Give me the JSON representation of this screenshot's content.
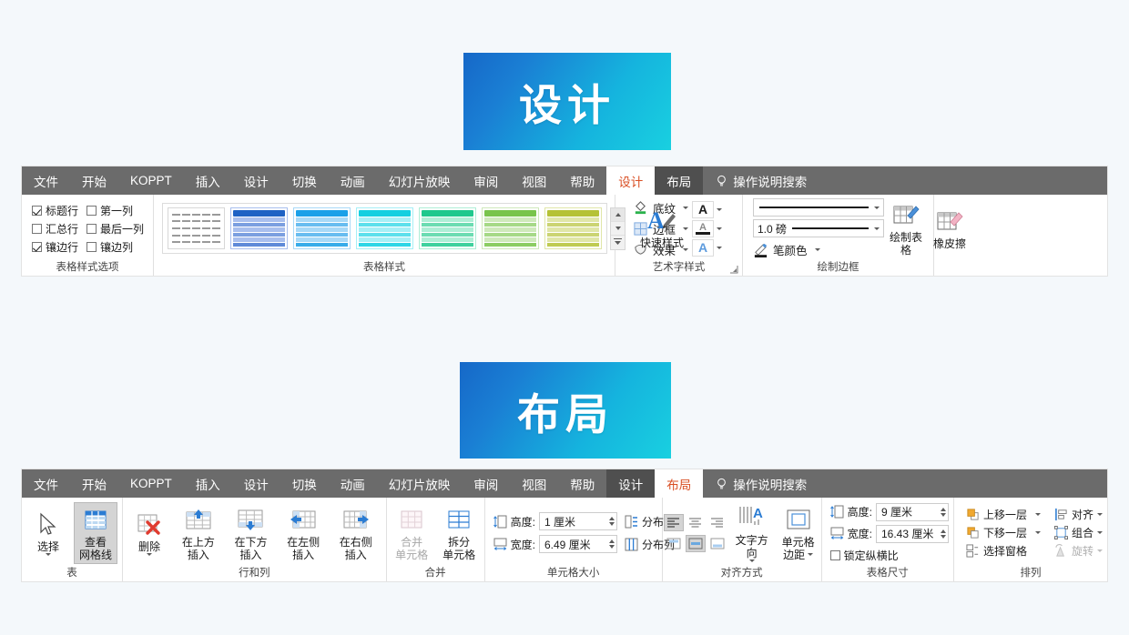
{
  "banners": {
    "design": "设计",
    "layout": "布局"
  },
  "colors": {
    "tabbar_bg": "#6b6b6b",
    "context_tab_bg": "#4f4f4f",
    "active_tab_text": "#d94f24",
    "banner_gradient_start": "#1668c8",
    "banner_gradient_end": "#19d0e0",
    "accent_blue": "#2b7cd3"
  },
  "ribbon_design": {
    "tabs": [
      {
        "label": "文件",
        "state": "normal"
      },
      {
        "label": "开始",
        "state": "normal"
      },
      {
        "label": "KOPPT",
        "state": "normal"
      },
      {
        "label": "插入",
        "state": "normal"
      },
      {
        "label": "设计",
        "state": "normal"
      },
      {
        "label": "切换",
        "state": "normal"
      },
      {
        "label": "动画",
        "state": "normal"
      },
      {
        "label": "幻灯片放映",
        "state": "normal"
      },
      {
        "label": "审阅",
        "state": "normal"
      },
      {
        "label": "视图",
        "state": "normal"
      },
      {
        "label": "帮助",
        "state": "normal"
      },
      {
        "label": "设计",
        "state": "active"
      },
      {
        "label": "布局",
        "state": "context"
      }
    ],
    "tell_me": "操作说明搜索",
    "groups": {
      "table_style_options": {
        "label": "表格样式选项",
        "checkboxes": [
          {
            "label": "标题行",
            "checked": true
          },
          {
            "label": "第一列",
            "checked": false
          },
          {
            "label": "汇总行",
            "checked": false
          },
          {
            "label": "最后一列",
            "checked": false
          },
          {
            "label": "镶边行",
            "checked": true
          },
          {
            "label": "镶边列",
            "checked": false
          }
        ]
      },
      "table_styles": {
        "label": "表格样式",
        "swatches": [
          {
            "name": "无样式网格型",
            "header": "#9a9a9a",
            "body": "#ffffff",
            "plain": true
          },
          {
            "name": "蓝色样式",
            "header": "#1f62c4",
            "body": "#7b9fe0",
            "alt": "#a9bfee"
          },
          {
            "name": "浅蓝样式",
            "header": "#1ba0e8",
            "body": "#68bdf0",
            "alt": "#a8d9f7"
          },
          {
            "name": "青色样式",
            "header": "#14cfe0",
            "body": "#5ce0ec",
            "alt": "#a6eff6"
          },
          {
            "name": "绿松石样式",
            "header": "#1fc88d",
            "body": "#6cdcb2",
            "alt": "#aeeed6"
          },
          {
            "name": "绿色样式",
            "header": "#79c44c",
            "body": "#a6d987",
            "alt": "#cfe9bb"
          },
          {
            "name": "橄榄色样式",
            "header": "#b5c236",
            "body": "#cbd472",
            "alt": "#e0e6a8"
          }
        ],
        "scroll_up": "上一行",
        "scroll_down": "下一行",
        "scroll_more": "其他"
      },
      "shading_menu": [
        {
          "label": "底纹",
          "icon": "shading-bucket-icon"
        },
        {
          "label": "边框",
          "icon": "borders-grid-icon"
        },
        {
          "label": "效果",
          "icon": "effects-icon"
        }
      ],
      "wordart_styles": {
        "label": "艺术字样式",
        "quick_style": "快速样式",
        "chips": [
          {
            "name": "text-fill",
            "glyph": "A"
          },
          {
            "name": "text-outline",
            "glyph": "A"
          },
          {
            "name": "text-effects",
            "glyph": "A"
          }
        ]
      },
      "draw_borders": {
        "label": "绘制边框",
        "pen_style_value": "",
        "pen_weight_value": "1.0 磅",
        "pen_color_label": "笔颜色",
        "draw_table": "绘制表格",
        "eraser": "橡皮擦"
      }
    }
  },
  "ribbon_layout": {
    "tabs": [
      {
        "label": "文件",
        "state": "normal"
      },
      {
        "label": "开始",
        "state": "normal"
      },
      {
        "label": "KOPPT",
        "state": "normal"
      },
      {
        "label": "插入",
        "state": "normal"
      },
      {
        "label": "设计",
        "state": "normal"
      },
      {
        "label": "切换",
        "state": "normal"
      },
      {
        "label": "动画",
        "state": "normal"
      },
      {
        "label": "幻灯片放映",
        "state": "normal"
      },
      {
        "label": "审阅",
        "state": "normal"
      },
      {
        "label": "视图",
        "state": "normal"
      },
      {
        "label": "帮助",
        "state": "normal"
      },
      {
        "label": "设计",
        "state": "context"
      },
      {
        "label": "布局",
        "state": "active"
      }
    ],
    "tell_me": "操作说明搜索",
    "groups": {
      "table": {
        "label": "表",
        "select": "选择",
        "view_gridlines_line1": "查看",
        "view_gridlines_line2": "网格线",
        "view_gridlines_selected": true
      },
      "rows_columns": {
        "label": "行和列",
        "delete": "删除",
        "insert_above": "在上方插入",
        "insert_below": "在下方插入",
        "insert_left": "在左侧插入",
        "insert_right": "在右侧插入"
      },
      "merge": {
        "label": "合并",
        "merge_cells_line1": "合并",
        "merge_cells_line2": "单元格",
        "merge_cells_disabled": true,
        "split_cells_line1": "拆分",
        "split_cells_line2": "单元格",
        "split_cells_disabled": false
      },
      "cell_size": {
        "label": "单元格大小",
        "height_label": "高度:",
        "height_value": "1 厘米",
        "width_label": "宽度:",
        "width_value": "6.49 厘米",
        "distribute_rows": "分布行",
        "distribute_cols": "分布列"
      },
      "alignment": {
        "label": "对齐方式",
        "align_left": "左对齐",
        "align_center": "居中",
        "align_right": "右对齐",
        "align_top": "顶端对齐",
        "align_middle": "垂直居中",
        "align_bottom": "底端对齐",
        "align_left_selected": true,
        "align_middle_selected": true,
        "text_direction": "文字方向",
        "cell_margins_line1": "单元格",
        "cell_margins_line2": "边距"
      },
      "table_size": {
        "label": "表格尺寸",
        "height_label": "高度:",
        "height_value": "9 厘米",
        "width_label": "宽度:",
        "width_value": "16.43 厘米",
        "lock_aspect": "锁定纵横比",
        "lock_aspect_checked": false
      },
      "arrange": {
        "label": "排列",
        "bring_forward": "上移一层",
        "send_backward": "下移一层",
        "selection_pane": "选择窗格",
        "align": "对齐",
        "group": "组合",
        "rotate": "旋转",
        "rotate_disabled": true
      }
    }
  }
}
